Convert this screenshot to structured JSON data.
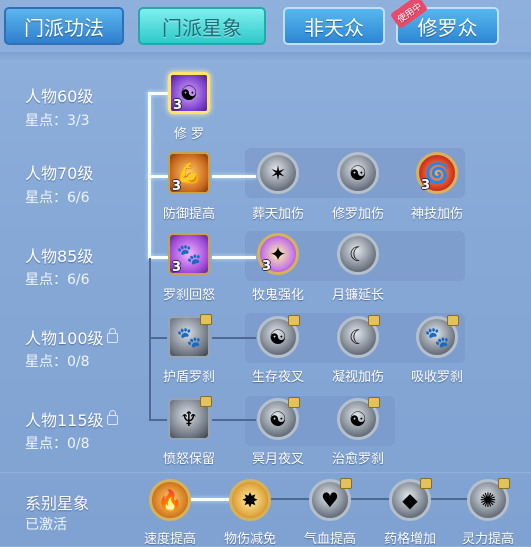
{
  "tabs": [
    {
      "label": "门派功法"
    },
    {
      "label": "门派星象"
    },
    {
      "label": "非天众"
    },
    {
      "label": "修罗众",
      "badge": "使用中"
    }
  ],
  "rows": [
    {
      "level": "人物60级",
      "points": "星点：3/3",
      "locked": false
    },
    {
      "level": "人物70级",
      "points": "星点：6/6",
      "locked": false
    },
    {
      "level": "人物85级",
      "points": "星点：6/6",
      "locked": false
    },
    {
      "level": "人物100级",
      "points": "星点：0/8",
      "locked": true
    },
    {
      "level": "人物115级",
      "points": "星点：0/8",
      "locked": true
    }
  ],
  "skills": {
    "r1": [
      {
        "label": "修 罗",
        "count": "3"
      }
    ],
    "r2": [
      {
        "label": "防御提高",
        "count": "3"
      },
      {
        "label": "葬天加伤",
        "count": ""
      },
      {
        "label": "修罗加伤",
        "count": ""
      },
      {
        "label": "神技加伤",
        "count": "3"
      }
    ],
    "r3": [
      {
        "label": "罗刹回怒",
        "count": "3"
      },
      {
        "label": "牧鬼强化",
        "count": "3"
      },
      {
        "label": "月镰延长",
        "count": ""
      }
    ],
    "r4": [
      {
        "label": "护盾罗刹"
      },
      {
        "label": "生存夜叉"
      },
      {
        "label": "凝视加伤"
      },
      {
        "label": "吸收罗刹"
      }
    ],
    "r5": [
      {
        "label": "愤怒保留"
      },
      {
        "label": "冥月夜叉"
      },
      {
        "label": "治愈罗刹"
      }
    ]
  },
  "system": {
    "title": "系别星象",
    "status": "已激活",
    "items": [
      {
        "label": "速度提高"
      },
      {
        "label": "物伤减免"
      },
      {
        "label": "气血提高"
      },
      {
        "label": "药格增加"
      },
      {
        "label": "灵力提高"
      }
    ]
  }
}
